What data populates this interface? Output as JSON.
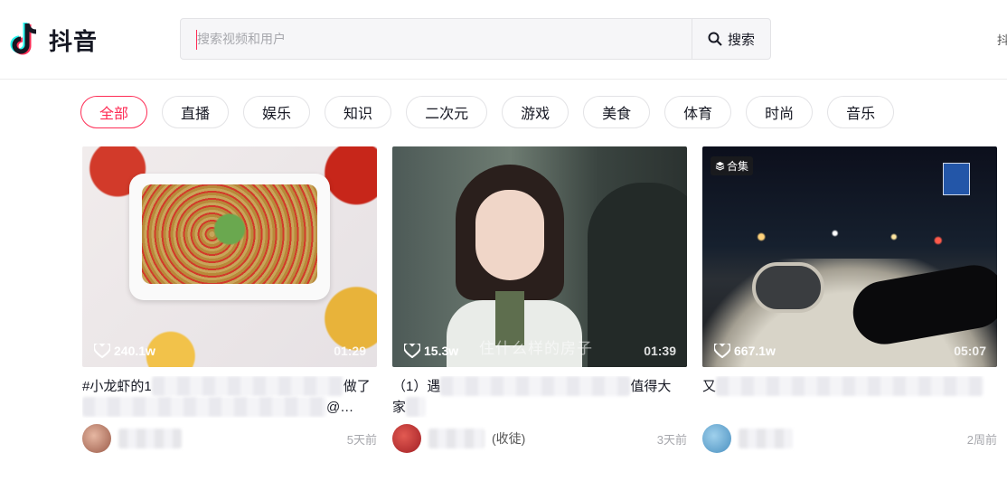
{
  "header": {
    "logo_text": "抖音",
    "search_placeholder": "搜索视频和用户",
    "search_button_label": "搜索",
    "right_text": "抖"
  },
  "tags": [
    "全部",
    "直播",
    "娱乐",
    "知识",
    "二次元",
    "游戏",
    "美食",
    "体育",
    "时尚",
    "音乐"
  ],
  "active_tag": "全部",
  "colors": {
    "accent": "#fe2c55",
    "text": "#161823",
    "muted": "#a6a7ac"
  },
  "videos": [
    {
      "likes": "240.1w",
      "duration": "01:29",
      "title_start": "#小龙虾的1",
      "title_end": "做了",
      "title_line2_end": "@…",
      "author_suffix": "",
      "time": "5天前",
      "thumb_icon": "food-thumbnail"
    },
    {
      "likes": "15.3w",
      "duration": "01:39",
      "caption_overlay": "住什么样的房子",
      "title_start": "（1）遇",
      "title_end": "值得大",
      "title_line2_start": "家",
      "author_suffix": "(收徒)",
      "time": "3天前",
      "thumb_icon": "drama-thumbnail"
    },
    {
      "likes": "667.1w",
      "duration": "05:07",
      "badge": "合集",
      "title_start": "又",
      "author_suffix": "",
      "time": "2周前",
      "thumb_icon": "night-drive-thumbnail"
    }
  ]
}
